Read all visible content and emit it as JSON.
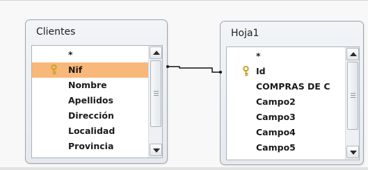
{
  "tables": [
    {
      "title": "Clientes",
      "fields": [
        {
          "label": "*",
          "key": false,
          "selected": false
        },
        {
          "label": "Nif",
          "key": true,
          "selected": true
        },
        {
          "label": "Nombre",
          "key": false,
          "selected": false
        },
        {
          "label": "Apellidos",
          "key": false,
          "selected": false
        },
        {
          "label": "Dirección",
          "key": false,
          "selected": false
        },
        {
          "label": "Localidad",
          "key": false,
          "selected": false
        },
        {
          "label": "Provincia",
          "key": false,
          "selected": false
        }
      ]
    },
    {
      "title": "Hoja1",
      "fields": [
        {
          "label": "*",
          "key": false,
          "selected": false
        },
        {
          "label": "Id",
          "key": true,
          "selected": false
        },
        {
          "label": "COMPRAS DE C",
          "key": false,
          "selected": false
        },
        {
          "label": "Campo2",
          "key": false,
          "selected": false
        },
        {
          "label": "Campo3",
          "key": false,
          "selected": false
        },
        {
          "label": "Campo4",
          "key": false,
          "selected": false
        },
        {
          "label": "Campo5",
          "key": false,
          "selected": false
        }
      ]
    }
  ],
  "relationship": {
    "from": "Clientes.Nif",
    "to": "Hoja1.Id"
  },
  "colors": {
    "selected_row": "#f8b879",
    "key_icon": "#c9a227"
  }
}
